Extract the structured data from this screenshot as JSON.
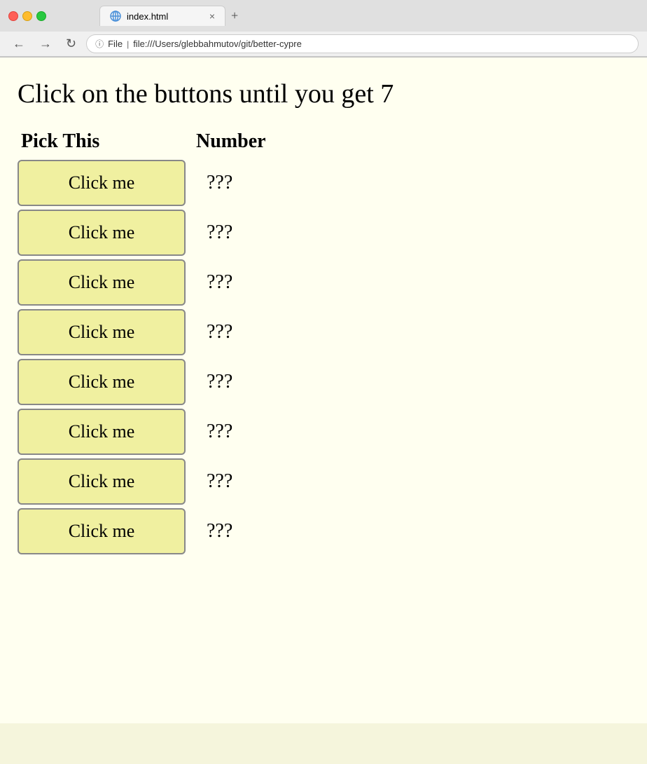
{
  "browser": {
    "tab_title": "index.html",
    "address_file_label": "File",
    "address_url": "file:///Users/glebbahmutov/git/better-cypre",
    "tab_close": "×",
    "tab_add": "+"
  },
  "page": {
    "title": "Click on the buttons until you get 7",
    "table": {
      "col1_header": "Pick This",
      "col2_header": "Number",
      "rows": [
        {
          "button_label": "Click me",
          "number": "???"
        },
        {
          "button_label": "Click me",
          "number": "???"
        },
        {
          "button_label": "Click me",
          "number": "???"
        },
        {
          "button_label": "Click me",
          "number": "???"
        },
        {
          "button_label": "Click me",
          "number": "???"
        },
        {
          "button_label": "Click me",
          "number": "???"
        },
        {
          "button_label": "Click me",
          "number": "???"
        },
        {
          "button_label": "Click me",
          "number": "???"
        }
      ]
    }
  }
}
